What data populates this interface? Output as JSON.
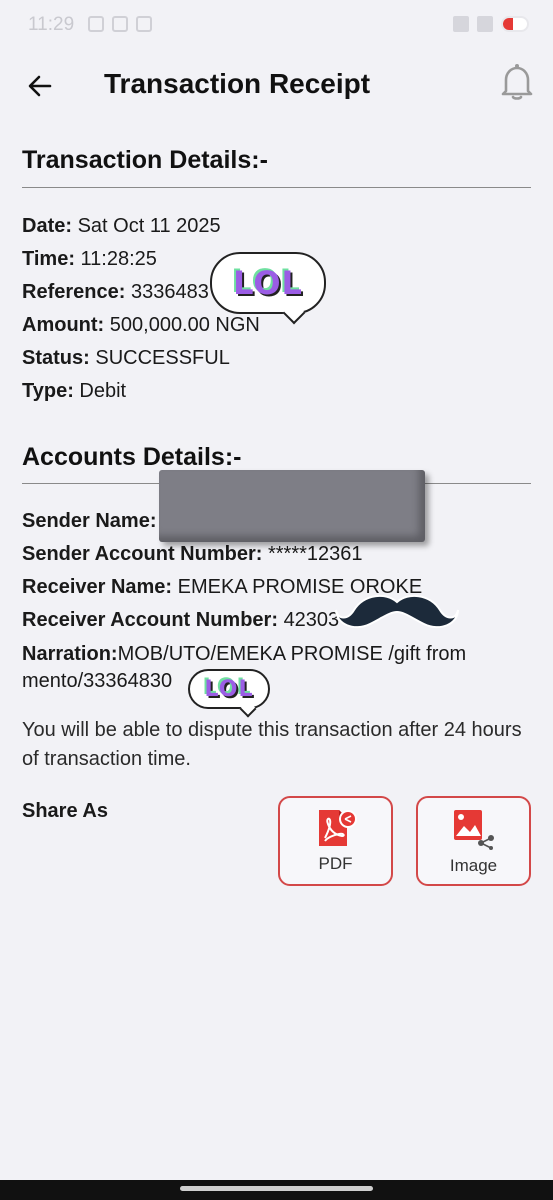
{
  "status_bar": {
    "time": "11:29"
  },
  "header": {
    "title": "Transaction Receipt",
    "back_icon": "arrow-left-icon",
    "bell_icon": "bell-icon"
  },
  "transaction": {
    "section_title": "Transaction Details:-",
    "rows": [
      {
        "label": "Date:",
        "value": "Sat Oct 11 2025"
      },
      {
        "label": "Time:",
        "value": "11:28:25"
      },
      {
        "label": "Reference:",
        "value": "3336483"
      },
      {
        "label": "Amount:",
        "value": "500,000.00 NGN"
      },
      {
        "label": "Status:",
        "value": "SUCCESSFUL"
      },
      {
        "label": "Type:",
        "value": "Debit"
      }
    ]
  },
  "accounts": {
    "section_title": "Accounts Details:-",
    "rows": [
      {
        "label": "Sender Name:",
        "value": ""
      },
      {
        "label": "Sender Account Number:",
        "value": "*****12361"
      },
      {
        "label": "Receiver Name:",
        "value": "EMEKA PROMISE OROKE"
      },
      {
        "label": "Receiver Account Number:",
        "value": "42303"
      }
    ],
    "narration_label": "Narration:",
    "narration_line1": "MOB/UTO/EMEKA PROMISE /gift from",
    "narration_line2": "mento/33364830"
  },
  "dispute_notice": "You will be able to dispute this transaction after 24 hours of transaction time.",
  "share": {
    "label": "Share As",
    "pdf_label": "PDF",
    "image_label": "Image"
  },
  "stickers": {
    "lol_text": "LOL"
  },
  "colors": {
    "accent_red": "#d34848",
    "background": "#f2f2f6"
  }
}
